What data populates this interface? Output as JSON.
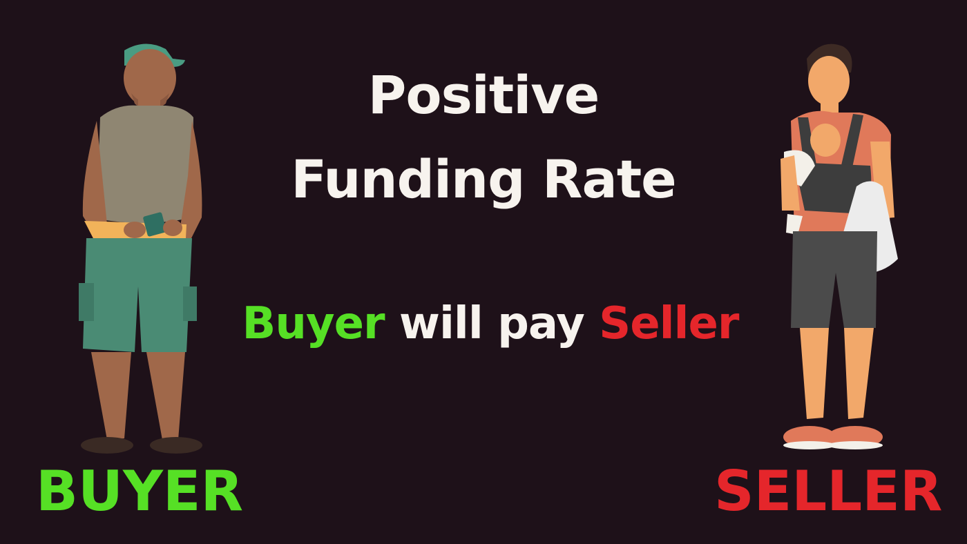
{
  "heading": {
    "line1": "Positive",
    "line2": "Funding Rate"
  },
  "tagline": {
    "buyer": "Buyer",
    "middle": " will pay ",
    "seller": "Seller"
  },
  "labels": {
    "buyer": "BUYER",
    "seller": "SELLER"
  },
  "colors": {
    "background": "#1e1119",
    "buyer": "#56e025",
    "seller": "#e5262b",
    "text": "#f7f3ee"
  },
  "illustrations": {
    "buyer": "man-with-cap-and-waist-bag-illustration",
    "seller": "man-carrying-baby-and-bag-illustration"
  }
}
